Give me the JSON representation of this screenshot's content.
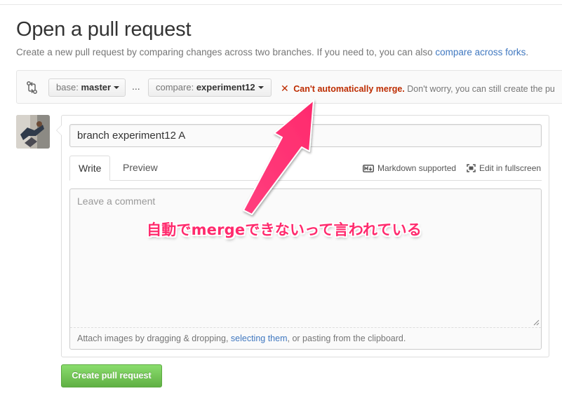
{
  "header": {
    "title": "Open a pull request",
    "subtitle": "Create a new pull request by comparing changes across two branches. If you need to, you can also",
    "subtitle_link": "compare across forks",
    "subtitle_end": "."
  },
  "range": {
    "base_label": "base:",
    "base_value": "master",
    "ellipsis": "...",
    "compare_label": "compare:",
    "compare_value": "experiment12",
    "merge_icon": "✕",
    "merge_status_bold": "Can't automatically merge.",
    "merge_status_rest": "Don't worry, you can still create the pu"
  },
  "form": {
    "title_value": "branch experiment12 A",
    "tabs": [
      {
        "label": "Write"
      },
      {
        "label": "Preview"
      }
    ],
    "markdown_note": "Markdown supported",
    "fullscreen_note": "Edit in fullscreen",
    "comment_placeholder": "Leave a comment",
    "attach_prefix": "Attach images by dragging & dropping,",
    "attach_link": "selecting them",
    "attach_suffix": ", or pasting from the clipboard."
  },
  "actions": {
    "create_label": "Create pull request"
  },
  "annotation": {
    "text": "自動でmergeできないって言われている"
  },
  "icons": {
    "compare": "git-compare-icon",
    "markdown": "markdown-icon",
    "fullscreen": "fullscreen-icon",
    "merge_fail": "x-icon"
  },
  "colors": {
    "link": "#4078c0",
    "error": "#bd2c00",
    "primary_button": "#60b044",
    "annotation": "#ff2a6d"
  }
}
